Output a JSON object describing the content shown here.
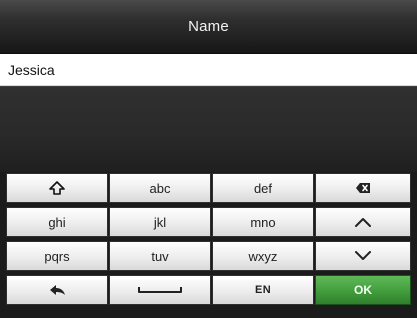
{
  "header": {
    "title": "Name"
  },
  "input": {
    "value": "Jessica"
  },
  "keyboard": {
    "row1": {
      "shift_icon": "shift-up-arrow-icon",
      "key2": "abc",
      "key3": "def",
      "backspace_icon": "backspace-icon"
    },
    "row2": {
      "key1": "ghi",
      "key2": "jkl",
      "key3": "mno",
      "up_icon": "chevron-up-icon"
    },
    "row3": {
      "key1": "pqrs",
      "key2": "tuv",
      "key3": "wxyz",
      "down_icon": "chevron-down-icon"
    },
    "row4": {
      "back_icon": "back-arrow-icon",
      "space_icon": "space-bar-icon",
      "lang": "EN",
      "ok": "OK"
    }
  },
  "colors": {
    "header_bg": "#2f2f2f",
    "ok_green": "#3f9a3a"
  }
}
